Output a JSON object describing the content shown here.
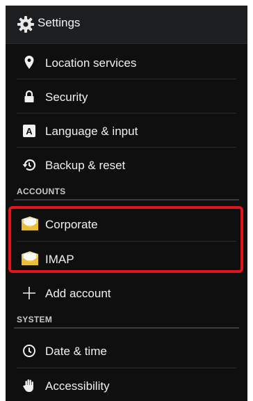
{
  "header": {
    "title": "Settings",
    "icon": "gear-icon"
  },
  "items": [
    {
      "label": "Location services",
      "icon": "location-pin-icon"
    },
    {
      "label": "Security",
      "icon": "lock-icon"
    },
    {
      "label": "Language & input",
      "icon": "keyboard-a-icon"
    },
    {
      "label": "Backup & reset",
      "icon": "restore-icon"
    }
  ],
  "accounts": {
    "header": "ACCOUNTS",
    "items": [
      {
        "label": "Corporate",
        "icon": "email-envelope-icon"
      },
      {
        "label": "IMAP",
        "icon": "email-envelope-icon"
      },
      {
        "label": "Add account",
        "icon": "plus-icon"
      }
    ]
  },
  "system": {
    "header": "SYSTEM",
    "items": [
      {
        "label": "Date & time",
        "icon": "clock-icon"
      },
      {
        "label": "Accessibility",
        "icon": "hand-icon"
      }
    ]
  },
  "colors": {
    "background": "#0f0f10",
    "action_bar": "#1d1e20",
    "text": "#f0f0f0",
    "highlight": "#e3151b"
  }
}
